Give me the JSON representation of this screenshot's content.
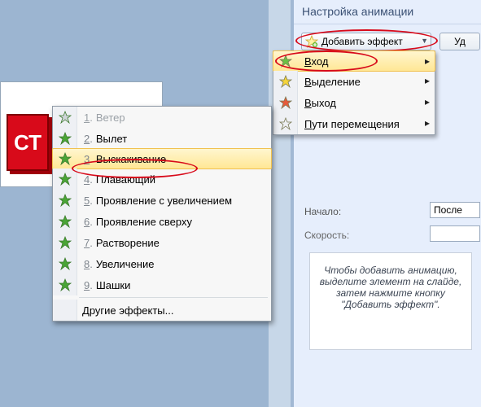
{
  "slide_text": "СТ",
  "panel": {
    "title": "Настройка анимации",
    "add_effect": "Добавить эффект",
    "remove_short": "Уд",
    "start_label": "Начало:",
    "start_value": "После",
    "speed_label": "Скорость:",
    "hint": "Чтобы добавить анимацию, выделите элемент на слайде, затем нажмите кнопку \"Добавить эффект\"."
  },
  "categories": [
    {
      "label": "Вход",
      "icon": "star-green",
      "highlight": true
    },
    {
      "label": "Выделение",
      "icon": "star-yellow",
      "highlight": false
    },
    {
      "label": "Выход",
      "icon": "star-red",
      "highlight": false
    },
    {
      "label": "Пути перемещения",
      "icon": "star-outline",
      "highlight": false
    }
  ],
  "effects": [
    {
      "n": "1",
      "label": "Ветер",
      "disabled": true,
      "highlight": false
    },
    {
      "n": "2",
      "label": "Вылет",
      "disabled": false,
      "highlight": false
    },
    {
      "n": "3",
      "label": "Выскакивание",
      "disabled": false,
      "highlight": true
    },
    {
      "n": "4",
      "label": "Плавающий",
      "disabled": false,
      "highlight": false
    },
    {
      "n": "5",
      "label": "Проявление с увеличением",
      "disabled": false,
      "highlight": false
    },
    {
      "n": "6",
      "label": "Проявление сверху",
      "disabled": false,
      "highlight": false
    },
    {
      "n": "7",
      "label": "Растворение",
      "disabled": false,
      "highlight": false
    },
    {
      "n": "8",
      "label": "Увеличение",
      "disabled": false,
      "highlight": false
    },
    {
      "n": "9",
      "label": "Шашки",
      "disabled": false,
      "highlight": false
    }
  ],
  "effects_other": "Другие эффекты...",
  "icons": {
    "add_star": "star-add",
    "fx_star": "star-green"
  }
}
